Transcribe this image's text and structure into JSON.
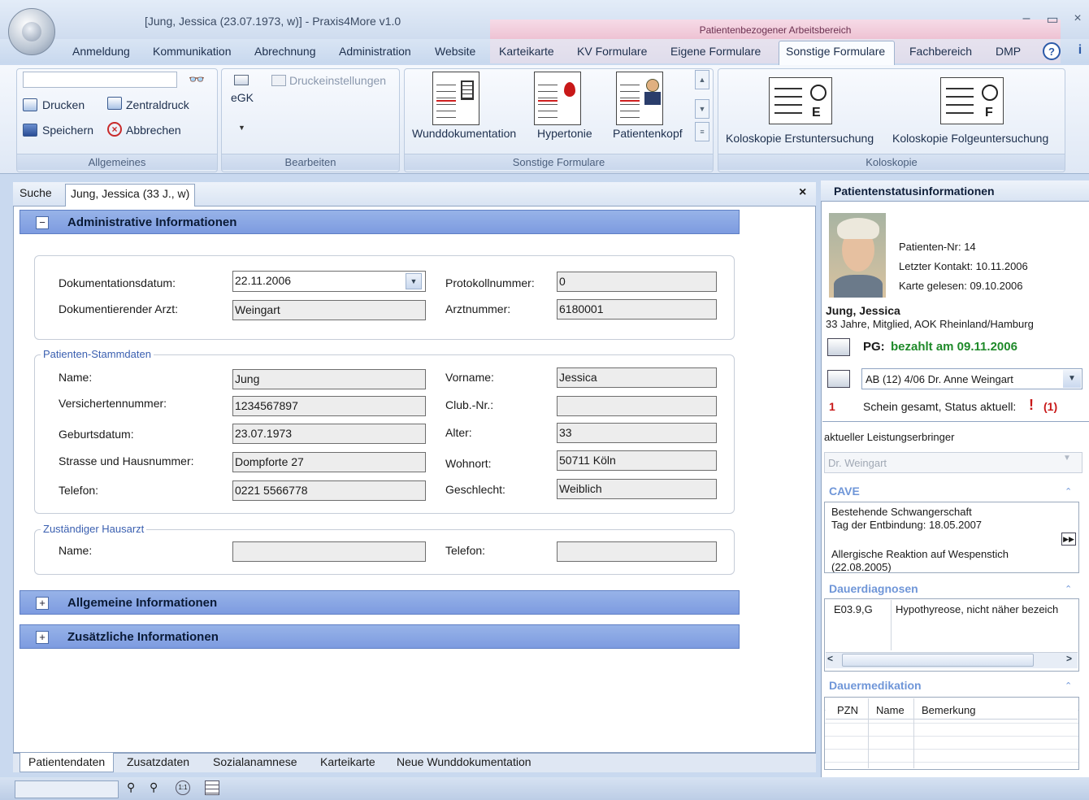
{
  "window": {
    "title": "[Jung, Jessica (23.07.1973, w)] - Praxis4More v1.0",
    "context_label": "Patientenbezogener Arbeitsbereich"
  },
  "menu": {
    "tabs": [
      "Anmeldung",
      "Kommunikation",
      "Abrechnung",
      "Administration",
      "Website",
      "Karteikarte",
      "KV Formulare",
      "Eigene Formulare",
      "Sonstige Formulare",
      "Fachbereich",
      "DMP"
    ],
    "active": "Sonstige Formulare"
  },
  "ribbon": {
    "allgemeines": {
      "label": "Allgemeines",
      "search_value": "",
      "drucken": "Drucken",
      "zentraldruck": "Zentraldruck",
      "speichern": "Speichern",
      "abbrechen": "Abbrechen"
    },
    "bearbeiten": {
      "label": "Bearbeiten",
      "egk": "eGK",
      "druckeinstellungen": "Druckeinstellungen"
    },
    "sonstige": {
      "label": "Sonstige Formulare",
      "items": [
        "Wunddokumentation",
        "Hypertonie",
        "Patientenkopf"
      ]
    },
    "koloskopie": {
      "label": "Koloskopie",
      "items": [
        "Koloskopie Erstuntersuchung",
        "Koloskopie Folgeuntersuchung"
      ],
      "badges": [
        "E",
        "F"
      ]
    }
  },
  "doc": {
    "tabs": [
      "Suche",
      "Jung, Jessica (33 J., w)"
    ],
    "close": "×"
  },
  "sections": {
    "admin": {
      "title": "Administrative Informationen",
      "toggle": "−"
    },
    "allgemein": {
      "title": "Allgemeine Informationen",
      "toggle": "+"
    },
    "zusatz": {
      "title": "Zusätzliche Informationen",
      "toggle": "+"
    }
  },
  "admin_fields": {
    "dokdatum_label": "Dokumentationsdatum:",
    "dokdatum_value": "22.11.2006",
    "arzt_label": "Dokumentierender Arzt:",
    "arzt_value": "Weingart",
    "protokoll_label": "Protokollnummer:",
    "protokoll_value": "0",
    "arztnr_label": "Arztnummer:",
    "arztnr_value": "6180001"
  },
  "stamm": {
    "legend": "Patienten-Stammdaten",
    "name_label": "Name:",
    "name_value": "Jung",
    "vorname_label": "Vorname:",
    "vorname_value": "Jessica",
    "versnr_label": "Versichertennummer:",
    "versnr_value": "1234567897",
    "club_label": "Club.-Nr.:",
    "club_value": "",
    "geb_label": "Geburtsdatum:",
    "geb_value": "23.07.1973",
    "alter_label": "Alter:",
    "alter_value": "33",
    "strasse_label": "Strasse und Hausnummer:",
    "strasse_value": "Dompforte 27",
    "wohnort_label": "Wohnort:",
    "wohnort_value": "50711 Köln",
    "tel_label": "Telefon:",
    "tel_value": "0221 5566778",
    "geschlecht_label": "Geschlecht:",
    "geschlecht_value": "Weiblich"
  },
  "hausarzt": {
    "legend": "Zuständiger Hausarzt",
    "name_label": "Name:",
    "name_value": "",
    "tel_label": "Telefon:",
    "tel_value": ""
  },
  "bottom_tabs": [
    "Patientendaten",
    "Zusatzdaten",
    "Sozialanamnese",
    "Karteikarte",
    "Neue Wunddokumentation"
  ],
  "patient_panel": {
    "title": "Patientenstatusinformationen",
    "patnr": "Patienten-Nr: 14",
    "letzter_kontakt": "Letzter Kontakt: 10.11.2006",
    "karte_gelesen": "Karte gelesen: 09.10.2006",
    "name": "Jung, Jessica",
    "details": "33 Jahre, Mitglied, AOK Rheinland/Hamburg",
    "pg_label": "PG:",
    "pg_status": "bezahlt am 09.11.2006",
    "schein_select": "AB (12) 4/06 Dr. Anne Weingart",
    "schein_count": "1",
    "schein_text": "Schein gesamt, Status aktuell:",
    "schein_flag": "!",
    "schein_flag_count": "(1)",
    "leistung_label": "aktueller Leistungserbringer",
    "leistung_value": "Dr. Weingart",
    "cave_title": "CAVE",
    "cave_lines": [
      "Bestehende Schwangerschaft",
      "Tag der Entbindung: 18.05.2007",
      "",
      "Allergische Reaktion auf Wespenstich",
      "(22.08.2005)"
    ],
    "dauerdiag_title": "Dauerdiagnosen",
    "dauerdiag_code": "E03.9,G",
    "dauerdiag_text": "Hypothyreose, nicht näher bezeich",
    "dauermed_title": "Dauermedikation",
    "dauermed_cols": [
      "PZN",
      "Name",
      "Bemerkung"
    ]
  },
  "colors": {
    "accent": "#7d9be0",
    "green": "#1f8a2a",
    "red": "#c81818",
    "context": "#eec2d3"
  }
}
